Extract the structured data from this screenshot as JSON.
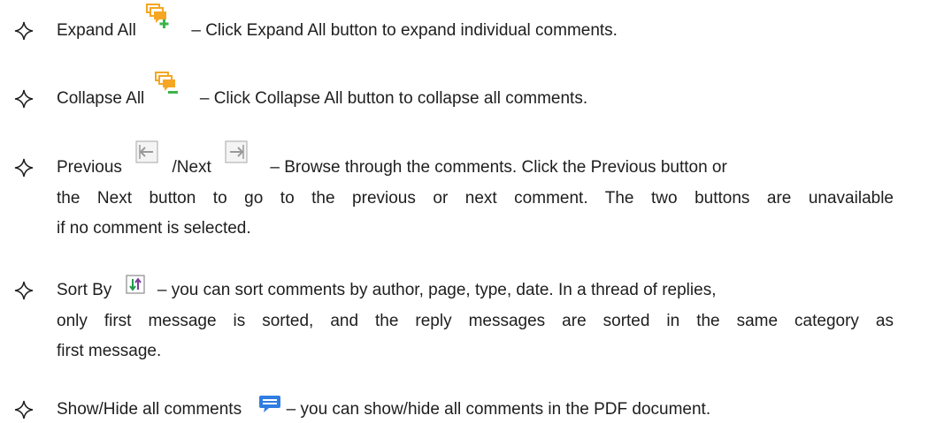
{
  "bullets": [
    {
      "name": "Expand All",
      "icon": "expand-all-icon",
      "desc": "– Click Expand All button to expand individual comments."
    },
    {
      "name": "Collapse All",
      "icon": "collapse-all-icon",
      "desc": "– Click Collapse All button to collapse all comments."
    },
    {
      "name": "Previous",
      "name2": "/Next",
      "icon": "previous-icon",
      "icon2": "next-icon",
      "desc": "– Browse through the comments. Click the Previous button or",
      "desc_2": "the Next button to go to the previous or next comment. The two buttons are unavailable",
      "desc_3": "if no comment is selected."
    },
    {
      "name": "Sort By",
      "icon": "sort-by-icon",
      "desc": "– you can sort comments by author, page, type, date. In a thread of replies,",
      "desc_2": "only first message is sorted, and the reply messages are sorted in the same category as",
      "desc_3": "first message."
    },
    {
      "name": "Show/Hide all comments",
      "icon": "show-hide-comments-icon",
      "desc": "– you can show/hide all comments in the PDF document."
    }
  ],
  "colors": {
    "text": "#1e1e1e",
    "comment_orange": "#f5a623",
    "plus_green": "#3cb44b",
    "nav_gray": "#9a9a9a",
    "sort_purple": "#7b3fa0",
    "sort_green": "#1f9a4a",
    "bubble_blue": "#2f7de1"
  }
}
